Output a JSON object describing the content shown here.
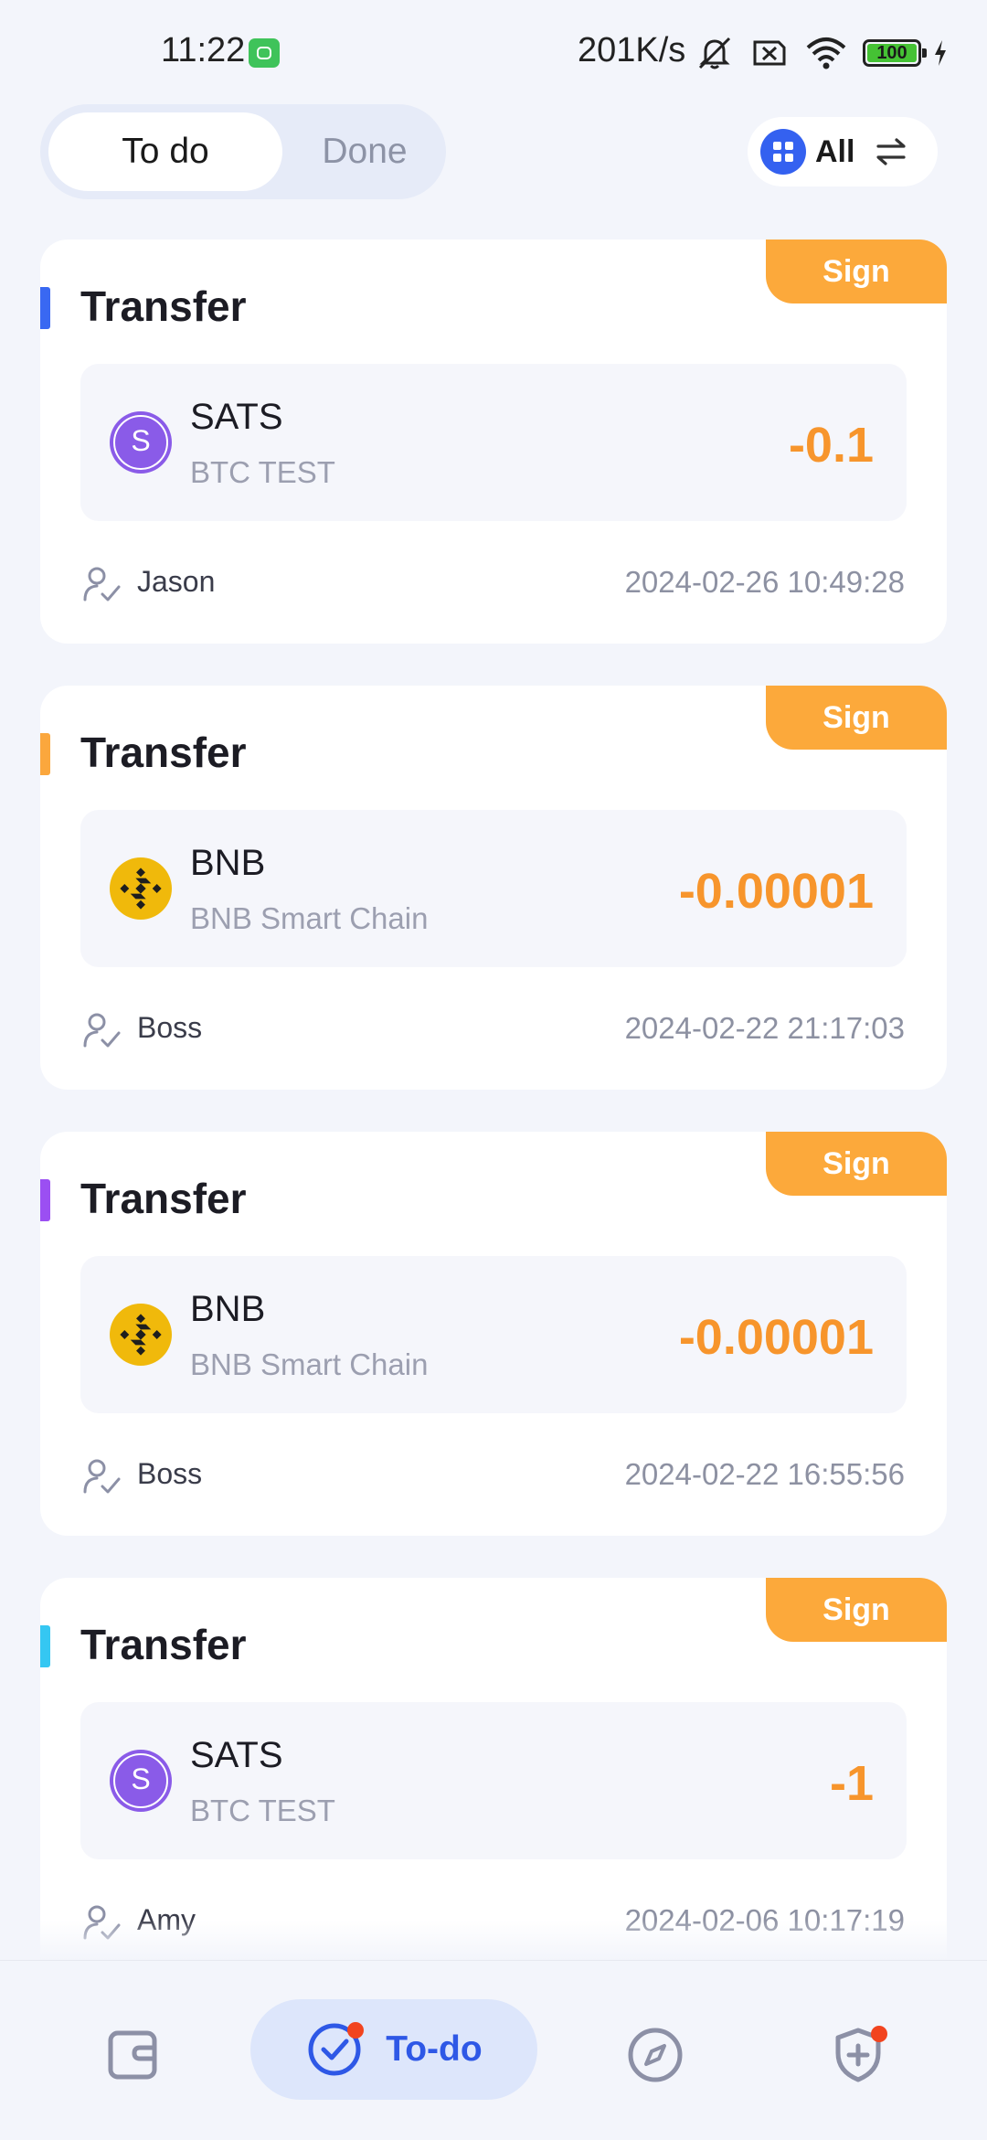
{
  "status_bar": {
    "time": "11:22",
    "network_speed": "201K/s",
    "battery": "100",
    "icons": [
      "cat-app-icon",
      "mute-icon",
      "sim-off-icon",
      "wifi-icon",
      "battery-icon",
      "charging-icon"
    ]
  },
  "tabs": {
    "todo": "To do",
    "done": "Done",
    "selected": "To do"
  },
  "filter": {
    "label": "All",
    "icons": [
      "grid-icon",
      "swap-icon"
    ]
  },
  "colors": {
    "accent_blue": "#3461f0",
    "sign_orange": "#fca93b",
    "amount_orange": "#f7952c",
    "background": "#f3f5fb"
  },
  "cards": [
    {
      "title": "Transfer",
      "action": "Sign",
      "accent": "#3968f2",
      "coin": "sats",
      "coin_letter": "S",
      "symbol": "SATS",
      "network": "BTC TEST",
      "amount": "-0.1",
      "user": "Jason",
      "time": "2024-02-26 10:49:28"
    },
    {
      "title": "Transfer",
      "action": "Sign",
      "accent": "#fba73d",
      "coin": "bnb",
      "coin_letter": "",
      "symbol": "BNB",
      "network": "BNB Smart Chain",
      "amount": "-0.00001",
      "user": "Boss",
      "time": "2024-02-22 21:17:03"
    },
    {
      "title": "Transfer",
      "action": "Sign",
      "accent": "#9b4ff2",
      "coin": "bnb",
      "coin_letter": "",
      "symbol": "BNB",
      "network": "BNB Smart Chain",
      "amount": "-0.00001",
      "user": "Boss",
      "time": "2024-02-22 16:55:56"
    },
    {
      "title": "Transfer",
      "action": "Sign",
      "accent": "#35c7f2",
      "coin": "sats",
      "coin_letter": "S",
      "symbol": "SATS",
      "network": "BTC TEST",
      "amount": "-1",
      "user": "Amy",
      "time": "2024-02-06 10:17:19"
    }
  ],
  "bottom_nav": {
    "items": [
      {
        "icon": "wallet-icon"
      },
      {
        "icon": "todo-check-icon",
        "label": "To-do",
        "active": true,
        "badge": true
      },
      {
        "icon": "compass-icon"
      },
      {
        "icon": "shield-plus-icon",
        "badge": true
      }
    ]
  }
}
